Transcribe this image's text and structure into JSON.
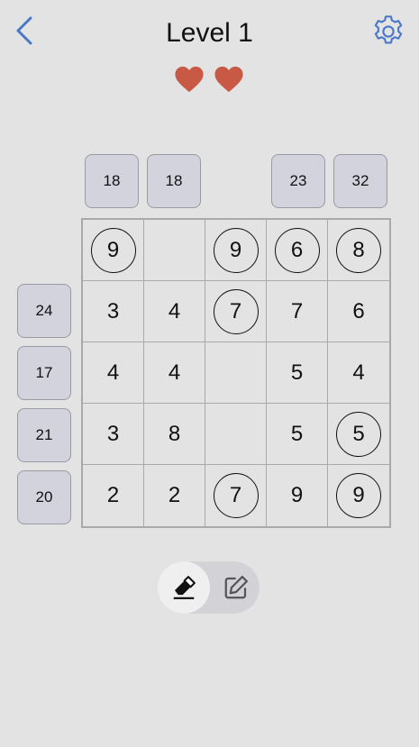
{
  "header": {
    "title": "Level 1",
    "back_icon": "chevron-left-icon",
    "settings_icon": "gear-icon",
    "accent_color": "#4a78c8"
  },
  "lives": {
    "count": 2,
    "icon": "heart-icon",
    "color": "#c85a45"
  },
  "column_clues": [
    "18",
    "18",
    "",
    "23",
    "32"
  ],
  "row_clues": [
    "",
    "24",
    "17",
    "21",
    "20"
  ],
  "grid": {
    "rows": [
      [
        {
          "v": "9",
          "c": true
        },
        {
          "v": "",
          "c": false
        },
        {
          "v": "9",
          "c": true
        },
        {
          "v": "6",
          "c": true
        },
        {
          "v": "8",
          "c": true
        }
      ],
      [
        {
          "v": "3",
          "c": false
        },
        {
          "v": "4",
          "c": false
        },
        {
          "v": "7",
          "c": true
        },
        {
          "v": "7",
          "c": false
        },
        {
          "v": "6",
          "c": false
        }
      ],
      [
        {
          "v": "4",
          "c": false
        },
        {
          "v": "4",
          "c": false
        },
        {
          "v": "",
          "c": false
        },
        {
          "v": "5",
          "c": false
        },
        {
          "v": "4",
          "c": false
        }
      ],
      [
        {
          "v": "3",
          "c": false
        },
        {
          "v": "8",
          "c": false
        },
        {
          "v": "",
          "c": false
        },
        {
          "v": "5",
          "c": false
        },
        {
          "v": "5",
          "c": true
        }
      ],
      [
        {
          "v": "2",
          "c": false
        },
        {
          "v": "2",
          "c": false
        },
        {
          "v": "7",
          "c": true
        },
        {
          "v": "9",
          "c": false
        },
        {
          "v": "9",
          "c": true
        }
      ]
    ]
  },
  "mode_toggle": {
    "selected": "erase",
    "erase_icon": "eraser-icon",
    "edit_icon": "pencil-edit-icon"
  }
}
